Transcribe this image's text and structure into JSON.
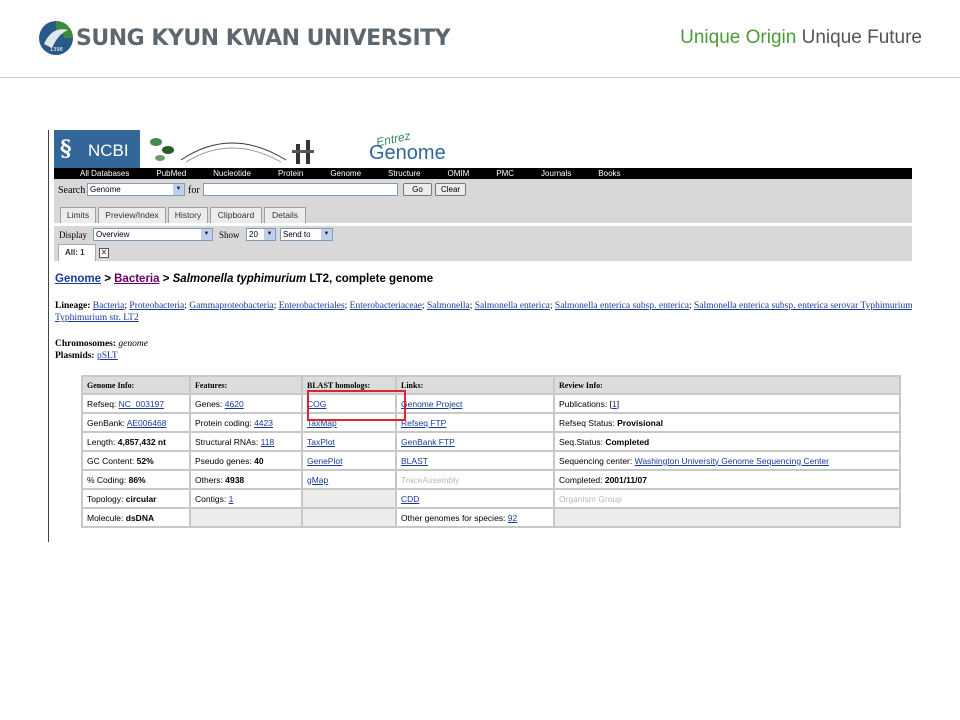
{
  "slide": {
    "university_name": "SUNG KYUN KWAN UNIVERSITY",
    "slogan_part1": "Unique Origin",
    "slogan_part2": "Unique Future",
    "colors": {
      "slogan_green": "#4b9b3a",
      "slogan_gray": "#555555",
      "logo_green": "#3c8c3c",
      "logo_blue": "#2a5a8a"
    }
  },
  "ncbi": {
    "logo_text": "NCBI",
    "banner_word": "Genome",
    "banner_entrez": "Entrez",
    "nav": [
      "All Databases",
      "PubMed",
      "Nucleotide",
      "Protein",
      "Genome",
      "Structure",
      "OMIM",
      "PMC",
      "Journals",
      "Books"
    ],
    "search": {
      "label": "Search",
      "database": "Genome",
      "for_label": "for",
      "query": "",
      "go_label": "Go",
      "clear_label": "Clear"
    },
    "tabs": [
      "Limits",
      "Preview/Index",
      "History",
      "Clipboard",
      "Details"
    ],
    "display": {
      "display_label": "Display",
      "format": "Overview",
      "show_label": "Show",
      "show_count": "20",
      "send_to": "Send to",
      "all_tab": "All: 1"
    },
    "colors": {
      "ncbi_blue": "#336699",
      "bar_gray": "#d8d8d8",
      "link_blue": "#1a3a9a",
      "visited": "#660066",
      "highlight_red": "#d8262c"
    }
  },
  "record": {
    "breadcrumb": {
      "genome": "Genome",
      "sep1": " > ",
      "bacteria": "Bacteria",
      "sep2": " > ",
      "organism": "Salmonella typhimurium",
      "title_rest": " LT2, complete genome"
    },
    "lineage": {
      "label": "Lineage:",
      "items": [
        "Bacteria",
        "Proteobacteria",
        "Gammaproteobacteria",
        "Enterobacteriales",
        "Enterobacteriaceae",
        "Salmonella",
        "Salmonella enterica",
        "Salmonella enterica subsp. enterica",
        "Salmonella enterica subsp. enterica serovar Typhimurium"
      ],
      "continuation": "Typhimurium str. LT2"
    },
    "chromosomes_label": "Chromosomes:",
    "chromosomes_value": "genome",
    "plasmids_label": "Plasmids:",
    "plasmids_value": "pSLT"
  },
  "info_table": {
    "headers": [
      "Genome Info:",
      "Features:",
      "BLAST homologs:",
      "Links:",
      "Review Info:"
    ],
    "genome_info": {
      "refseq_label": "Refseq:",
      "refseq": "NC_003197",
      "genbank_label": "GenBank:",
      "genbank": "AE006468",
      "length_label": "Length:",
      "length": "4,857,432 nt",
      "gc_label": "GC Content:",
      "gc": "52%",
      "coding_label": "% Coding:",
      "coding": "86%",
      "topology_label": "Topology:",
      "topology": "circular",
      "molecule_label": "Molecule:",
      "molecule": "dsDNA"
    },
    "features": {
      "genes_label": "Genes:",
      "genes": "4620",
      "protein_label": "Protein coding:",
      "protein": "4423",
      "rna_label": "Structural RNAs:",
      "rna": "118",
      "pseudo_label": "Pseudo genes:",
      "pseudo": "40",
      "others_label": "Others:",
      "others": "4938",
      "contigs_label": "Contigs:",
      "contigs": "1"
    },
    "blast": [
      "COG",
      "TaxMap",
      "TaxPlot",
      "GenePlot",
      "gMap"
    ],
    "links": {
      "genome_project": "Genome Project",
      "refseq_ftp": "Refseq FTP",
      "genbank_ftp": "GenBank FTP",
      "blast": "BLAST",
      "trace": "TraceAssembly",
      "cdd": "CDD",
      "other_label": "Other genomes for species:",
      "other_count": "92"
    },
    "review": {
      "pubs_label": "Publications:",
      "pubs_open": "[",
      "pubs": "1",
      "pubs_close": "]",
      "status_label": "Refseq Status:",
      "status": "Provisional",
      "seq_label": "Seq.Status:",
      "seq": "Completed",
      "center_label": "Sequencing center:",
      "center": "Washington University Genome Sequencing Center",
      "completed_label": "Completed:",
      "completed": "2001/11/07",
      "organism_group": "Organism Group"
    }
  }
}
